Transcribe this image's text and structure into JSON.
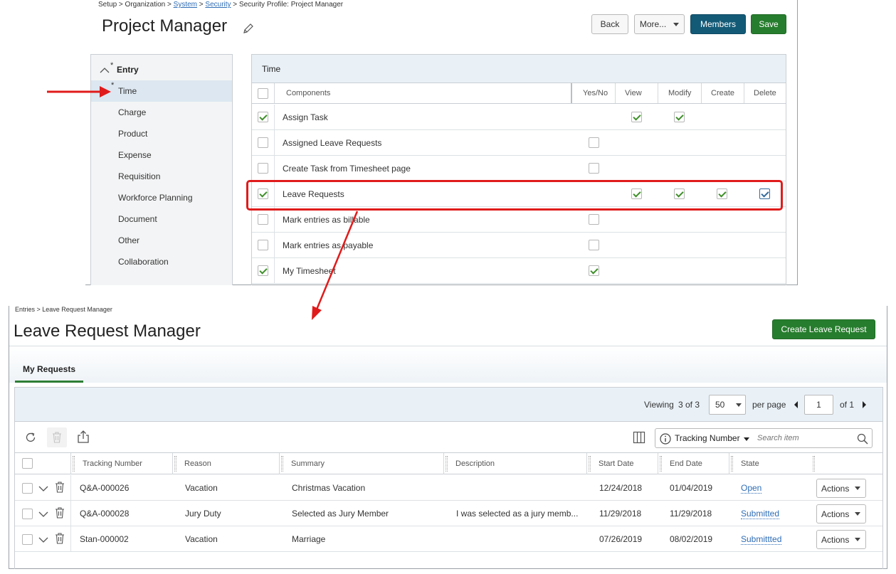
{
  "security": {
    "breadcrumb": {
      "setup": "Setup",
      "sep": " > ",
      "organization": "Organization",
      "system": "System",
      "security": "Security",
      "current": "Security Profile: Project Manager"
    },
    "title": "Project Manager",
    "buttons": {
      "back": "Back",
      "more": "More...",
      "members": "Members",
      "save": "Save"
    },
    "nav": {
      "group": "Entry",
      "items": [
        "Time",
        "Charge",
        "Product",
        "Expense",
        "Requisition",
        "Workforce Planning",
        "Document",
        "Other",
        "Collaboration"
      ],
      "active_index": 0
    },
    "grid": {
      "title": "Time",
      "columns": {
        "components": "Components",
        "yesno": "Yes/No",
        "view": "View",
        "modify": "Modify",
        "create": "Create",
        "delete": "Delete"
      },
      "rows": [
        {
          "label": "Assign Task",
          "selected": true,
          "yesno": null,
          "view": true,
          "modify": true,
          "create": null,
          "delete": null
        },
        {
          "label": "Assigned Leave Requests",
          "selected": false,
          "yesno": false,
          "view": null,
          "modify": null,
          "create": null,
          "delete": null
        },
        {
          "label": "Create Task from Timesheet page",
          "selected": false,
          "yesno": false,
          "view": null,
          "modify": null,
          "create": null,
          "delete": null
        },
        {
          "label": "Leave Requests",
          "selected": true,
          "yesno": null,
          "view": true,
          "modify": true,
          "create": true,
          "delete": true
        },
        {
          "label": "Mark entries as billable",
          "selected": false,
          "yesno": false,
          "view": null,
          "modify": null,
          "create": null,
          "delete": null
        },
        {
          "label": "Mark entries as payable",
          "selected": false,
          "yesno": false,
          "view": null,
          "modify": null,
          "create": null,
          "delete": null
        },
        {
          "label": "My Timesheet",
          "selected": true,
          "yesno": true,
          "view": null,
          "modify": null,
          "create": null,
          "delete": null
        }
      ]
    }
  },
  "leave": {
    "breadcrumb": {
      "entries": "Entries",
      "sep": " > ",
      "current": "Leave Request Manager"
    },
    "title": "Leave Request Manager",
    "create_button": "Create Leave Request",
    "tab": "My Requests",
    "pager": {
      "viewing": "Viewing",
      "count": "3 of 3",
      "per_page_value": "50",
      "per_page_label": "per page",
      "page": "1",
      "of_total": "of 1"
    },
    "search": {
      "field": "Tracking Number",
      "placeholder": "Search item"
    },
    "columns": [
      "Tracking Number",
      "Reason",
      "Summary",
      "Description",
      "Start Date",
      "End Date",
      "State"
    ],
    "rows": [
      {
        "tracking": "Q&A-000026",
        "reason": "Vacation",
        "summary": "Christmas Vacation",
        "description": "",
        "start": "12/24/2018",
        "end": "01/04/2019",
        "state": "Open"
      },
      {
        "tracking": "Q&A-000028",
        "reason": "Jury Duty",
        "summary": "Selected as Jury Member",
        "description": "I was selected as a jury memb...",
        "start": "11/29/2018",
        "end": "11/29/2018",
        "state": "Submitted"
      },
      {
        "tracking": "Stan-000002",
        "reason": "Vacation",
        "summary": "Marriage",
        "description": "",
        "start": "07/26/2019",
        "end": "08/02/2019",
        "state": "Submittted"
      }
    ],
    "actions_label": "Actions"
  },
  "colors": {
    "annotation_red": "#e01b1b",
    "members_navy": "#135a77",
    "save_green": "#277d2e",
    "link_blue": "#2f6db5"
  }
}
